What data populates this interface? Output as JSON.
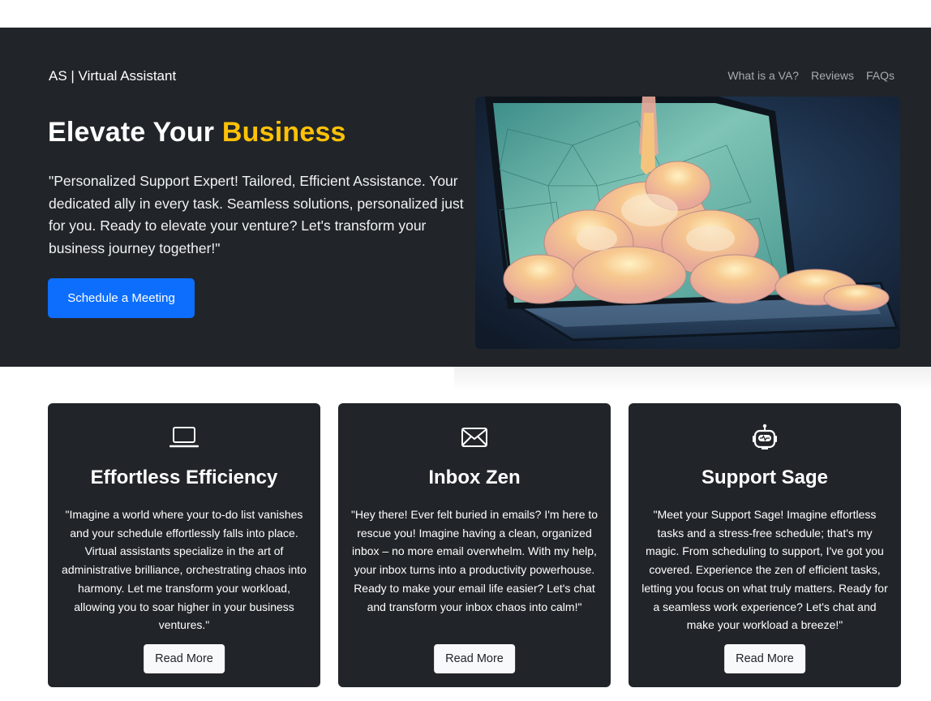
{
  "header": {
    "brand": "AS | Virtual Assistant",
    "nav": [
      "What is a VA?",
      "Reviews",
      "FAQs"
    ]
  },
  "hero": {
    "title_main": "Elevate Your ",
    "title_accent": "Business",
    "lead": "\"Personalized Support Expert! Tailored, Efficient Assistance. Your dedicated ally in every task. Seamless solutions, personalized just for you. Ready to elevate your venture? Let's transform your business journey together!\"",
    "cta_label": "Schedule a Meeting",
    "image": "laptop-rocket-launch-illustration"
  },
  "cards": [
    {
      "icon": "laptop-icon",
      "title": "Effortless Efficiency",
      "text": "\"Imagine a world where your to-do list vanishes and your schedule effortlessly falls into place. Virtual assistants specialize in the art of administrative brilliance, orchestrating chaos into harmony. Let me transform your workload, allowing you to soar higher in your business ventures.\"",
      "button": "Read More"
    },
    {
      "icon": "envelope-icon",
      "title": "Inbox Zen",
      "text": "\"Hey there! Ever felt buried in emails? I'm here to rescue you! Imagine having a clean, organized inbox – no more email overwhelm. With my help, your inbox turns into a productivity powerhouse. Ready to make your email life easier? Let's chat and transform your inbox chaos into calm!\"",
      "button": "Read More"
    },
    {
      "icon": "robot-icon",
      "title": "Support Sage",
      "text": "\"Meet your Support Sage! Imagine effortless tasks and a stress-free schedule; that's my magic. From scheduling to support, I've got you covered. Experience the zen of efficient tasks, letting you focus on what truly matters. Ready for a seamless work experience? Let's chat and make your workload a breeze!\"",
      "button": "Read More"
    }
  ],
  "colors": {
    "dark_bg": "#212529",
    "accent": "#ffc107",
    "primary_button": "#0d6efd",
    "light_button": "#f8f9fa"
  }
}
